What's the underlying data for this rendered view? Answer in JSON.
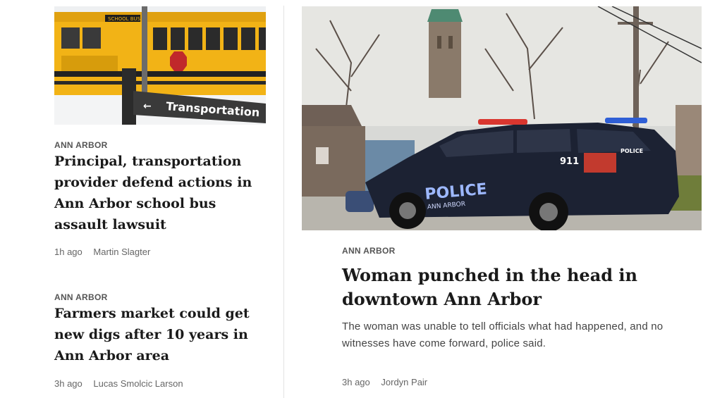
{
  "stories": [
    {
      "kicker": "ANN ARBOR",
      "headline": "Principal, transportation provider defend actions in Ann Arbor school bus assault lawsuit",
      "age": "1h ago",
      "author": "Martin Slagter",
      "image": {
        "sign_text": "Transportation",
        "bus_text": "SCHOOL BUS"
      }
    },
    {
      "kicker": "ANN ARBOR",
      "headline": "Farmers market could get new digs after 10 years in Ann Arbor area",
      "age": "3h ago",
      "author": "Lucas Smolcic Larson"
    },
    {
      "kicker": "ANN ARBOR",
      "headline": "Woman punched in the head in downtown Ann Arbor",
      "summary": "The woman was unable to tell officials what had happened, and no witnesses have come forward, police said.",
      "age": "3h ago",
      "author": "Jordyn Pair",
      "image": {
        "door_text": "POLICE",
        "door_sub": "ANN ARBOR",
        "unit_text": "911",
        "rear_text": "POLICE"
      }
    }
  ],
  "colors": {
    "kicker": "#555555",
    "headline": "#1a1a1a",
    "meta": "#666666",
    "divider": "#e3e3e3"
  }
}
